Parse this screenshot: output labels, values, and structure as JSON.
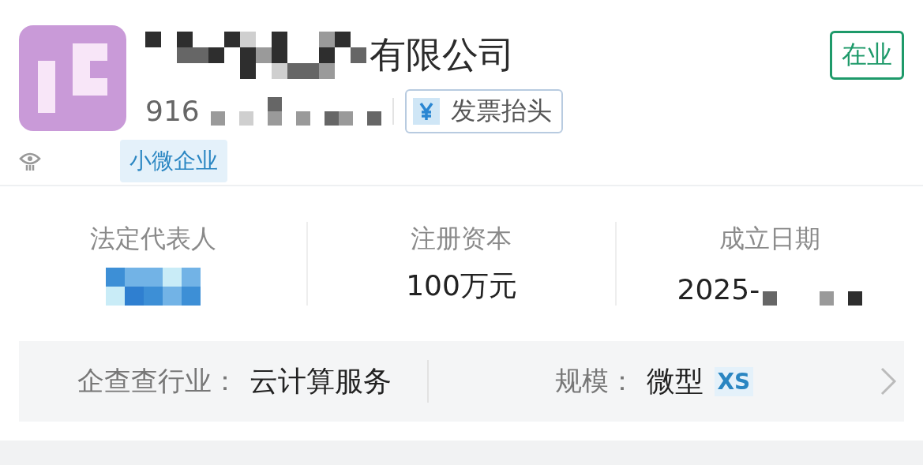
{
  "company": {
    "name_visible": "有限公司",
    "status": "在业",
    "credit_code_visible": "916",
    "invoice_button": "发票抬头",
    "tags": [
      "小微企业"
    ]
  },
  "stats": [
    {
      "kind": "redacted",
      "label": "法定代表人"
    },
    {
      "kind": "text",
      "label": "注册资本",
      "value": "100万元"
    },
    {
      "kind": "partial",
      "label": "成立日期",
      "value": "2025-"
    }
  ],
  "industry": {
    "label": "企查查行业：",
    "value": "云计算服务"
  },
  "scale": {
    "label": "规模：",
    "value": "微型",
    "badge": "XS"
  }
}
